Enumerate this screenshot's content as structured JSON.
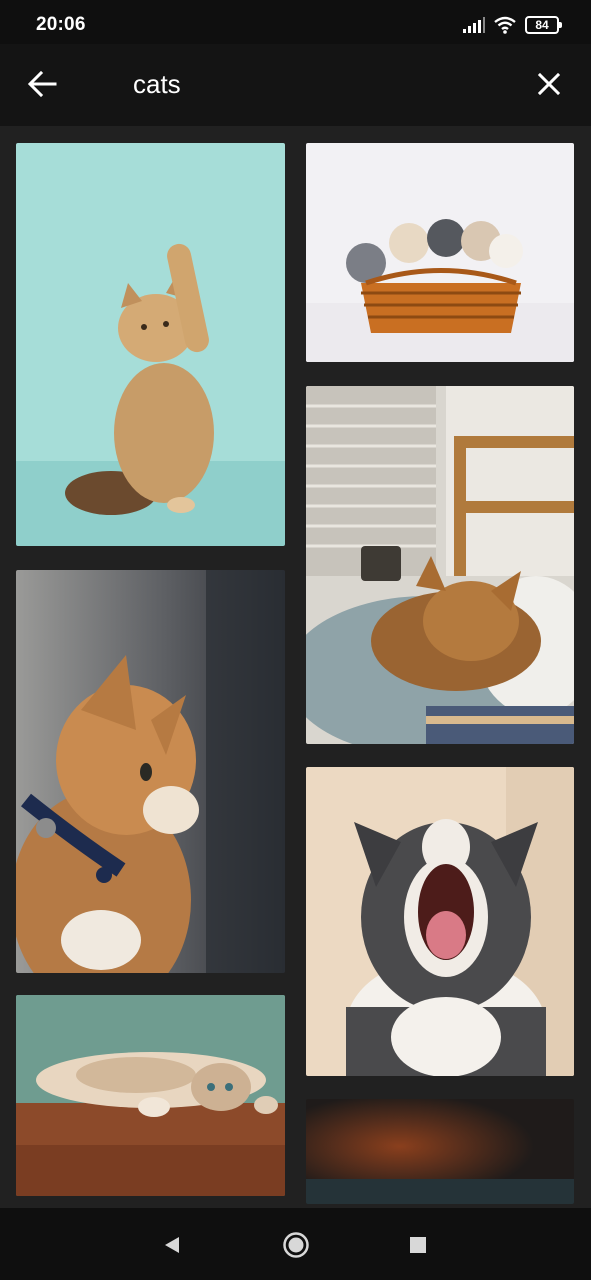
{
  "status_bar": {
    "time": "20:06",
    "battery": "84",
    "icons": [
      "signal-icon",
      "wifi-icon",
      "battery-icon"
    ]
  },
  "toolbar": {
    "back_icon": "arrow-left-icon",
    "query": "cats",
    "close_icon": "close-icon"
  },
  "results": {
    "left_column": [
      "kitten-raising-paw-on-teal-photo",
      "ginger-cat-with-blue-collar-photo",
      "cat-lying-upside-down-on-floor-photo"
    ],
    "right_column": [
      "kittens-in-wicker-basket-photo",
      "tabby-cat-sleeping-on-bed-photo",
      "cat-yawning-photo",
      "blurred-dark-photo"
    ]
  },
  "nav_bar": {
    "icons": [
      "back-triangle-icon",
      "home-circle-icon",
      "recents-square-icon"
    ]
  }
}
